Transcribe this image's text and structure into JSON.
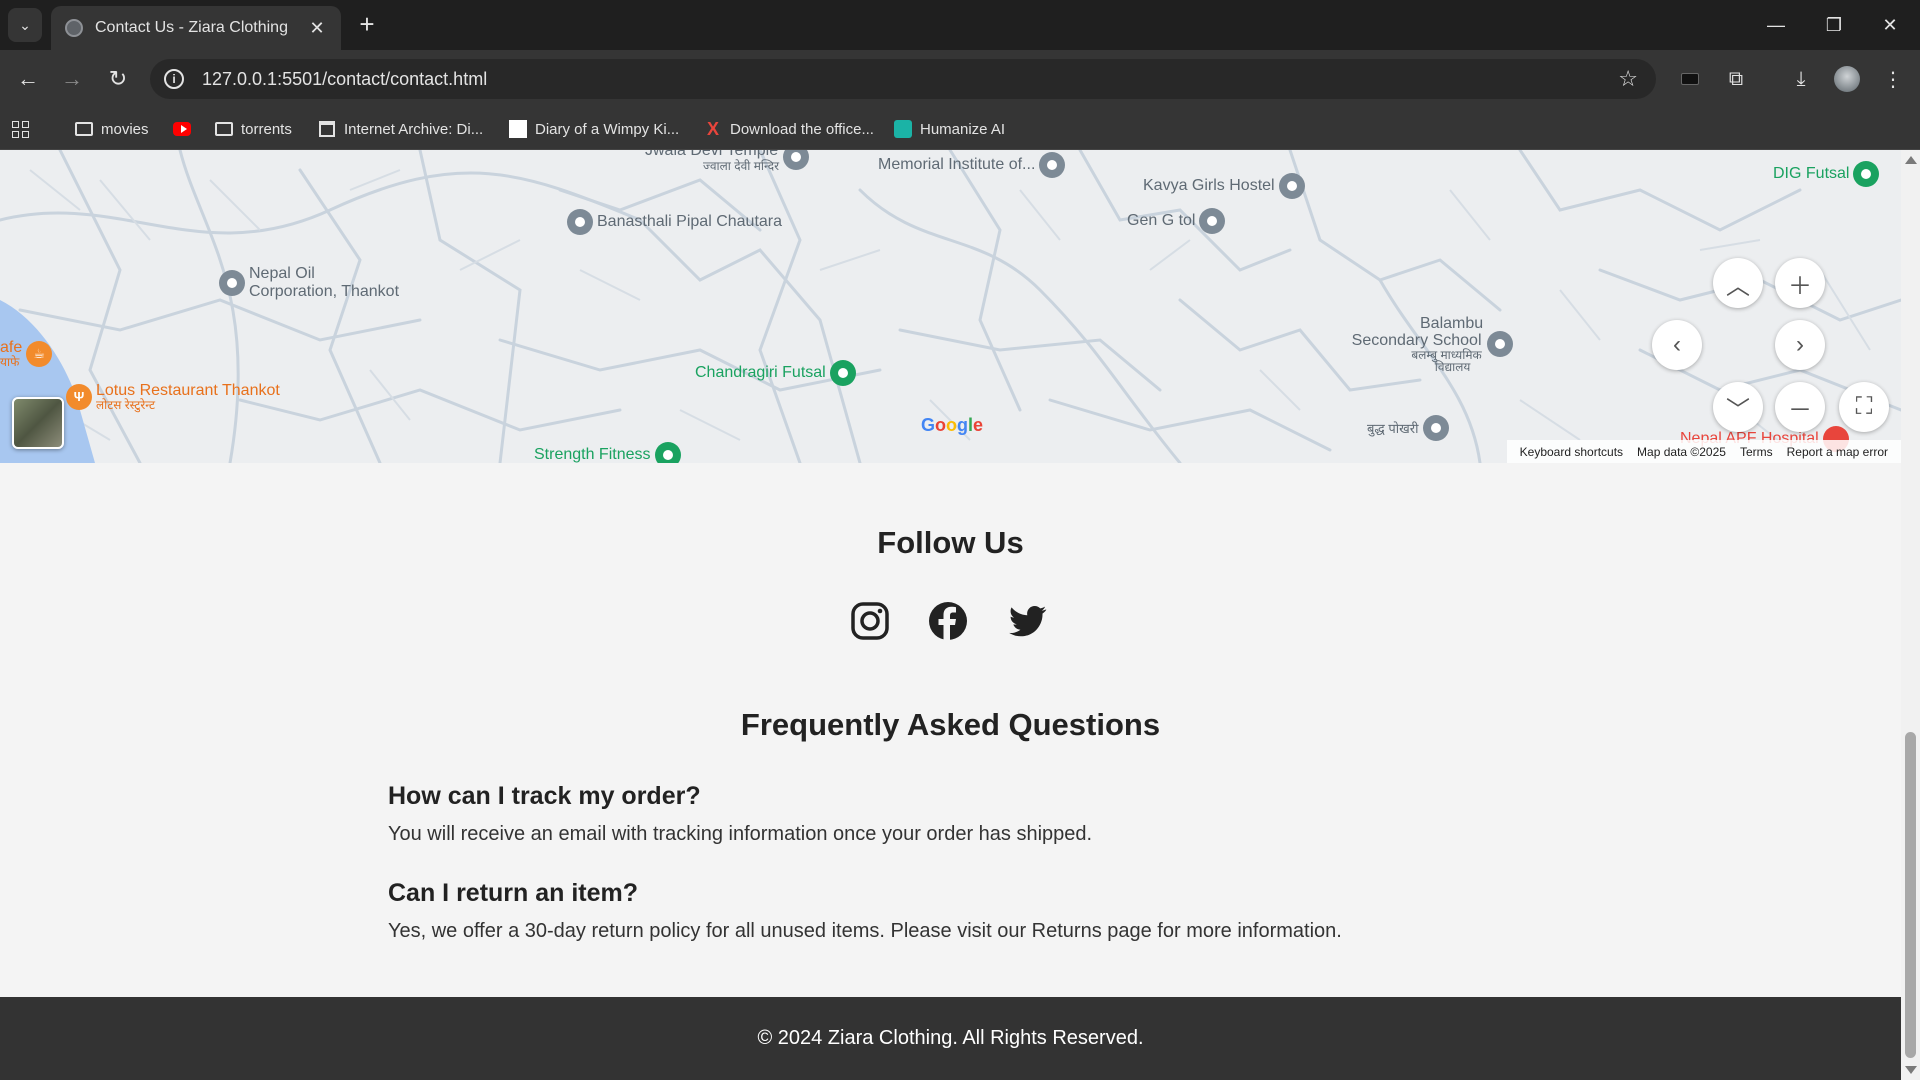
{
  "browser": {
    "tab_title": "Contact Us - Ziara Clothing",
    "url": "127.0.0.1:5501/contact/contact.html",
    "bookmarks": [
      {
        "label": "movies",
        "icon": "folder-icon"
      },
      {
        "label": "",
        "icon": "youtube-icon"
      },
      {
        "label": "torrents",
        "icon": "folder-icon"
      },
      {
        "label": "Internet Archive: Di...",
        "icon": "internet-archive-icon"
      },
      {
        "label": "Diary of a Wimpy Ki...",
        "icon": "page-icon"
      },
      {
        "label": "Download the office...",
        "icon": "x-icon"
      },
      {
        "label": "Humanize AI",
        "icon": "humanize-icon"
      }
    ]
  },
  "map": {
    "places": {
      "jwala": "Jwala Devi Temple",
      "jwala_np": "ज्वाला देवी मन्दिर",
      "memorial": "Memorial Institute of...",
      "kavya": "Kavya Girls Hostel",
      "dig": "DIG Futsal",
      "banasthali": "Banasthali Pipal Chautara",
      "gen_g": "Gen G tol",
      "nepal_oil_1": "Nepal Oil",
      "nepal_oil_2": "Corporation, Thankot",
      "balambu_1": "Balambu",
      "balambu_2": "Secondary School",
      "balambu_np_1": "बलम्बु माध्यमिक",
      "balambu_np_2": "विद्यालय",
      "cafe": "afe",
      "cafe_np": "याफे",
      "lotus": "Lotus Restaurant Thankot",
      "lotus_np": "लोटस रेस्टुरेन्ट",
      "chandragiri": "Chandragiri Futsal",
      "buddha": "बुद्ध पोखरी",
      "strength": "Strength Fitness",
      "apf": "Nepal APF Hospital"
    },
    "google_logo": "Google",
    "attribution": [
      "Keyboard shortcuts",
      "Map data ©2025",
      "Terms",
      "Report a map error"
    ]
  },
  "follow": {
    "title": "Follow Us"
  },
  "faq": {
    "title": "Frequently Asked Questions",
    "items": [
      {
        "q": "How can I track my order?",
        "a": "You will receive an email with tracking information once your order has shipped."
      },
      {
        "q": "Can I return an item?",
        "a": "Yes, we offer a 30-day return policy for all unused items. Please visit our Returns page for more information."
      }
    ]
  },
  "footer": {
    "text": "© 2024 Ziara Clothing. All Rights Reserved."
  }
}
